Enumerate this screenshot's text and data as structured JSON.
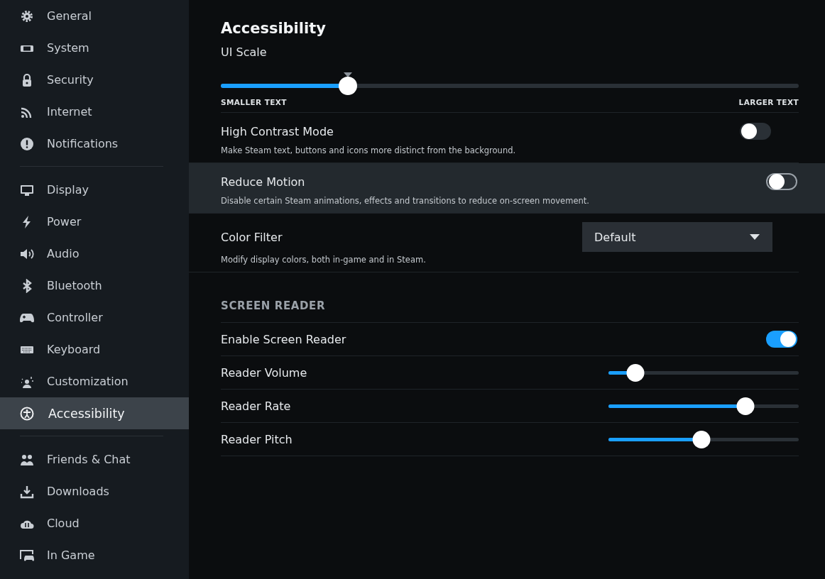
{
  "sidebar": {
    "groups": [
      [
        {
          "label": "General",
          "selected": false
        },
        {
          "label": "System",
          "selected": false
        },
        {
          "label": "Security",
          "selected": false
        },
        {
          "label": "Internet",
          "selected": false
        },
        {
          "label": "Notifications",
          "selected": false
        }
      ],
      [
        {
          "label": "Display",
          "selected": false
        },
        {
          "label": "Power",
          "selected": false
        },
        {
          "label": "Audio",
          "selected": false
        },
        {
          "label": "Bluetooth",
          "selected": false
        },
        {
          "label": "Controller",
          "selected": false
        },
        {
          "label": "Keyboard",
          "selected": false
        },
        {
          "label": "Customization",
          "selected": false
        },
        {
          "label": "Accessibility",
          "selected": true
        }
      ],
      [
        {
          "label": "Friends & Chat",
          "selected": false
        },
        {
          "label": "Downloads",
          "selected": false
        },
        {
          "label": "Cloud",
          "selected": false
        },
        {
          "label": "In Game",
          "selected": false
        }
      ]
    ]
  },
  "page": {
    "title": "Accessibility",
    "ui_scale": {
      "label": "UI Scale",
      "level": 0.22,
      "min_label": "SMALLER TEXT",
      "max_label": "LARGER TEXT"
    },
    "settings": [
      {
        "label": "High Contrast Mode",
        "description": "Make Steam text, buttons and icons more distinct from the background.",
        "on": false,
        "focused": false
      },
      {
        "label": "Reduce Motion",
        "description": "Disable certain Steam animations, effects and transitions to reduce on-screen movement.",
        "on": false,
        "focused": true
      }
    ],
    "color_filter": {
      "label": "Color Filter",
      "value": "Default",
      "description": "Modify display colors, both in-game and in Steam."
    },
    "section_title": "SCREEN READER",
    "screen_reader": [
      {
        "kind": "toggle",
        "label": "Enable Screen Reader",
        "on": true
      },
      {
        "kind": "slider",
        "label": "Reader Volume",
        "level": 0.14
      },
      {
        "kind": "slider",
        "label": "Reader Rate",
        "level": 0.72
      },
      {
        "kind": "slider",
        "label": "Reader Pitch",
        "level": 0.49
      }
    ]
  }
}
